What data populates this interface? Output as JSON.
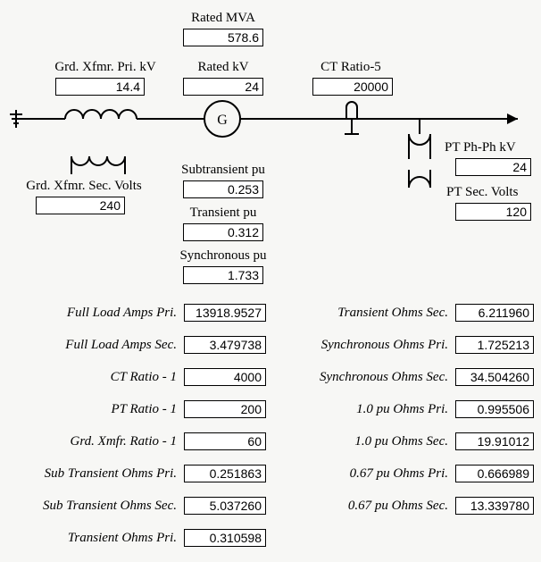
{
  "top": {
    "rated_mva_label": "Rated MVA",
    "rated_mva": "578.6",
    "grd_xfmr_pri_label": "Grd. Xfmr. Pri. kV",
    "grd_xfmr_pri": "14.4",
    "rated_kv_label": "Rated kV",
    "rated_kv": "24",
    "ct_ratio5_label": "CT Ratio-5",
    "ct_ratio5": "20000",
    "grd_xfmr_sec_label": "Grd. Xfmr. Sec. Volts",
    "grd_xfmr_sec": "240",
    "subtransient_label": "Subtransient pu",
    "subtransient": "0.253",
    "transient_label": "Transient pu",
    "transient": "0.312",
    "synchronous_label": "Synchronous pu",
    "synchronous": "1.733",
    "pt_phph_label": "PT Ph-Ph kV",
    "pt_phph": "24",
    "pt_sec_label": "PT Sec. Volts",
    "pt_sec": "120",
    "gen_symbol": "G"
  },
  "left": [
    {
      "label": "Full Load Amps Pri.",
      "val": "13918.9527"
    },
    {
      "label": "Full Load Amps Sec.",
      "val": "3.479738"
    },
    {
      "label": "CT Ratio - 1",
      "val": "4000"
    },
    {
      "label": "PT Ratio - 1",
      "val": "200"
    },
    {
      "label": "Grd. Xmfr. Ratio - 1",
      "val": "60"
    },
    {
      "label": "Sub Transient Ohms Pri.",
      "val": "0.251863"
    },
    {
      "label": "Sub Transient Ohms Sec.",
      "val": "5.037260"
    },
    {
      "label": "Transient Ohms Pri.",
      "val": "0.310598"
    }
  ],
  "right": [
    {
      "label": "Transient Ohms Sec.",
      "val": "6.211960"
    },
    {
      "label": "Synchronous Ohms Pri.",
      "val": "1.725213"
    },
    {
      "label": "Synchronous Ohms Sec.",
      "val": "34.504260"
    },
    {
      "label": "1.0 pu Ohms Pri.",
      "val": "0.995506"
    },
    {
      "label": "1.0 pu Ohms Sec.",
      "val": "19.91012"
    },
    {
      "label": "0.67 pu Ohms Pri.",
      "val": "0.666989"
    },
    {
      "label": "0.67 pu Ohms Sec.",
      "val": "13.339780"
    }
  ]
}
